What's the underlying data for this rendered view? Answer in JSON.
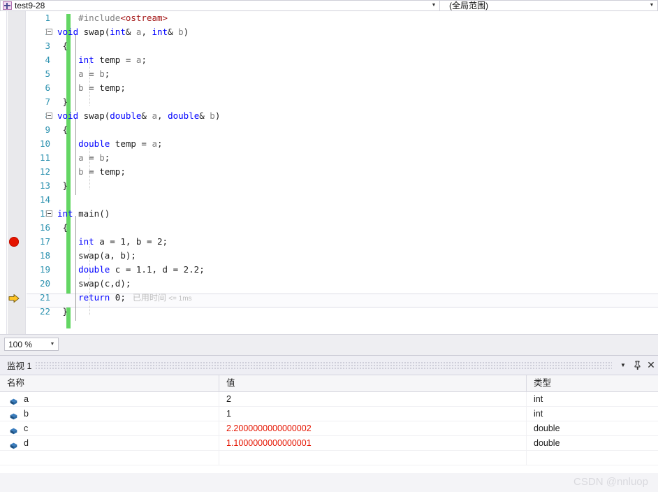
{
  "navbar": {
    "scope_combo": {
      "label": "test9-28",
      "icon": "file-cpp-icon",
      "arrow": "▼"
    },
    "member_combo": {
      "label": "(全局范围)",
      "arrow": "▼"
    }
  },
  "editor": {
    "lines": [
      {
        "num": "1",
        "tokens": [
          {
            "t": "#include",
            "c": "pp"
          },
          {
            "t": "<ostream>",
            "c": "str"
          }
        ],
        "indent": 4
      },
      {
        "num": "2",
        "tokens": [
          {
            "t": "void",
            "c": "kw"
          },
          {
            "t": " swap(",
            "c": "pl"
          },
          {
            "t": "int",
            "c": "kw"
          },
          {
            "t": "& ",
            "c": "pl"
          },
          {
            "t": "a",
            "c": "id"
          },
          {
            "t": ", ",
            "c": "pl"
          },
          {
            "t": "int",
            "c": "kw"
          },
          {
            "t": "& ",
            "c": "pl"
          },
          {
            "t": "b",
            "c": "id"
          },
          {
            "t": ")",
            "c": "pl"
          }
        ],
        "indent": 0
      },
      {
        "num": "3",
        "tokens": [
          {
            "t": "{",
            "c": "pl"
          }
        ],
        "indent": 1
      },
      {
        "num": "4",
        "tokens": [
          {
            "t": "int",
            "c": "kw"
          },
          {
            "t": " temp = ",
            "c": "pl"
          },
          {
            "t": "a",
            "c": "id"
          },
          {
            "t": ";",
            "c": "pl"
          }
        ],
        "indent": 4
      },
      {
        "num": "5",
        "tokens": [
          {
            "t": "a",
            "c": "id"
          },
          {
            "t": " = ",
            "c": "pl"
          },
          {
            "t": "b",
            "c": "id"
          },
          {
            "t": ";",
            "c": "pl"
          }
        ],
        "indent": 4
      },
      {
        "num": "6",
        "tokens": [
          {
            "t": "b",
            "c": "id"
          },
          {
            "t": " = temp;",
            "c": "pl"
          }
        ],
        "indent": 4
      },
      {
        "num": "7",
        "tokens": [
          {
            "t": "}",
            "c": "pl"
          }
        ],
        "indent": 1
      },
      {
        "num": "8",
        "tokens": [
          {
            "t": "void",
            "c": "kw"
          },
          {
            "t": " swap(",
            "c": "pl"
          },
          {
            "t": "double",
            "c": "kw"
          },
          {
            "t": "& ",
            "c": "pl"
          },
          {
            "t": "a",
            "c": "id"
          },
          {
            "t": ", ",
            "c": "pl"
          },
          {
            "t": "double",
            "c": "kw"
          },
          {
            "t": "& ",
            "c": "pl"
          },
          {
            "t": "b",
            "c": "id"
          },
          {
            "t": ")",
            "c": "pl"
          }
        ],
        "indent": 0
      },
      {
        "num": "9",
        "tokens": [
          {
            "t": "{",
            "c": "pl"
          }
        ],
        "indent": 1
      },
      {
        "num": "10",
        "tokens": [
          {
            "t": "double",
            "c": "kw"
          },
          {
            "t": " temp = ",
            "c": "pl"
          },
          {
            "t": "a",
            "c": "id"
          },
          {
            "t": ";",
            "c": "pl"
          }
        ],
        "indent": 4
      },
      {
        "num": "11",
        "tokens": [
          {
            "t": "a",
            "c": "id"
          },
          {
            "t": " = ",
            "c": "pl"
          },
          {
            "t": "b",
            "c": "id"
          },
          {
            "t": ";",
            "c": "pl"
          }
        ],
        "indent": 4
      },
      {
        "num": "12",
        "tokens": [
          {
            "t": "b",
            "c": "id"
          },
          {
            "t": " = temp;",
            "c": "pl"
          }
        ],
        "indent": 4
      },
      {
        "num": "13",
        "tokens": [
          {
            "t": "}",
            "c": "pl"
          }
        ],
        "indent": 1
      },
      {
        "num": "14",
        "tokens": [],
        "indent": 0
      },
      {
        "num": "15",
        "tokens": [
          {
            "t": "int",
            "c": "kw"
          },
          {
            "t": " main()",
            "c": "pl"
          }
        ],
        "indent": 0
      },
      {
        "num": "16",
        "tokens": [
          {
            "t": "{",
            "c": "pl"
          }
        ],
        "indent": 1
      },
      {
        "num": "17",
        "tokens": [
          {
            "t": "int",
            "c": "kw"
          },
          {
            "t": " a = 1, b = 2;",
            "c": "pl"
          }
        ],
        "indent": 4
      },
      {
        "num": "18",
        "tokens": [
          {
            "t": "swap(a, b);",
            "c": "pl"
          }
        ],
        "indent": 4
      },
      {
        "num": "19",
        "tokens": [
          {
            "t": "double",
            "c": "kw"
          },
          {
            "t": " c = 1.1, d = 2.2;",
            "c": "pl"
          }
        ],
        "indent": 4
      },
      {
        "num": "20",
        "tokens": [
          {
            "t": "swap(c,d);",
            "c": "pl"
          }
        ],
        "indent": 4
      },
      {
        "num": "21",
        "tokens": [
          {
            "t": "return",
            "c": "kw"
          },
          {
            "t": " 0;",
            "c": "pl"
          }
        ],
        "indent": 4
      },
      {
        "num": "22",
        "tokens": [
          {
            "t": "}",
            "c": "pl"
          }
        ],
        "indent": 1
      }
    ],
    "elapsed_annotation": {
      "text": "已用时间",
      "value": "<= 1ms"
    },
    "breakpoint_line": "17",
    "current_line": "21",
    "fold_lines": [
      "2",
      "8",
      "15"
    ],
    "colors": {
      "keyword": "#0000ff",
      "string": "#a31515",
      "preprocessor": "#808080",
      "identifier": "#808080",
      "linenumber": "#2b91af",
      "changebar": "#63d663",
      "breakpoint": "#e51400"
    }
  },
  "zoombar": {
    "zoom_level": "100 %",
    "arrow": "▼"
  },
  "watch": {
    "title": "监视 1",
    "buttons": {
      "dropdown": "▼",
      "pin": "pin-icon",
      "close": "✕"
    },
    "columns": [
      "名称",
      "值",
      "类型"
    ],
    "rows": [
      {
        "name": "a",
        "value": "2",
        "type": "int",
        "changed": false
      },
      {
        "name": "b",
        "value": "1",
        "type": "int",
        "changed": false
      },
      {
        "name": "c",
        "value": "2.2000000000000002",
        "type": "double",
        "changed": true
      },
      {
        "name": "d",
        "value": "1.1000000000000001",
        "type": "double",
        "changed": true
      },
      {
        "name": "",
        "value": "",
        "type": "",
        "changed": false
      }
    ]
  },
  "watermark": "CSDN @nnluop"
}
